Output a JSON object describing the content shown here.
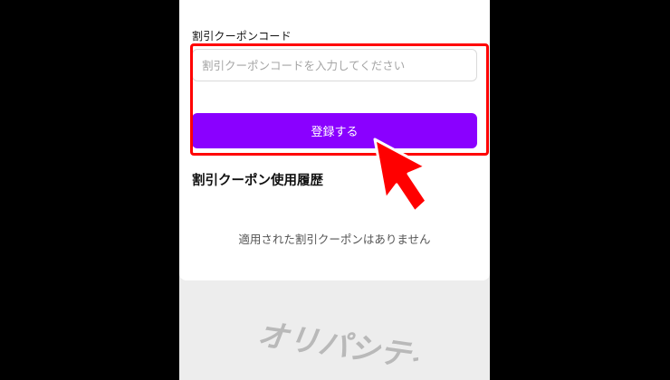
{
  "coupon": {
    "label": "割引クーポンコード",
    "placeholder": "割引クーポンコードを入力してください",
    "value": "",
    "register_label": "登録する"
  },
  "history": {
    "title": "割引クーポン使用履歴",
    "empty_message": "適用された割引クーポンはありません"
  },
  "brand": {
    "logo_text": "オリパシティ"
  },
  "colors": {
    "accent": "#8a00ff",
    "highlight": "#ff0000",
    "background": "#000000",
    "card": "#ffffff",
    "footer": "#ededed",
    "logo": "#b9b9b9"
  },
  "icons": {
    "pointer": "red-arrow-pointer-icon"
  }
}
